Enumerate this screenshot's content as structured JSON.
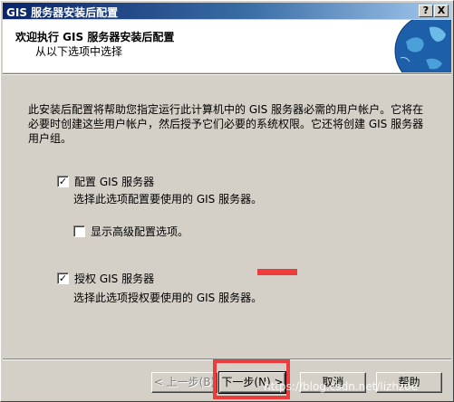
{
  "window": {
    "title": "GIS 服务器安装后配置",
    "help_btn": "?",
    "close_btn": "X"
  },
  "header": {
    "title": "欢迎执行 GIS 服务器安装后配置",
    "subtitle": "从以下选项中选择"
  },
  "description": "此安装后配置将帮助您指定运行此计算机中的 GIS 服务器必需的用户帐户。它将在必要时创建这些用户帐户，然后授予它们必要的系统权限。它还将创建 GIS 服务器用户组。",
  "options": {
    "configure": {
      "label": "配置 GIS 服务器",
      "checked": true,
      "check_glyph": "✓",
      "note": "选择此选项配置要使用的 GIS 服务器。"
    },
    "advanced": {
      "label": "显示高级配置选项。",
      "checked": false
    },
    "authorize": {
      "label": "授权 GIS 服务器",
      "checked": true,
      "check_glyph": "✓",
      "note": "选择此选项授权要使用的 GIS 服务器。"
    }
  },
  "buttons": {
    "back": "< 上一步(B)",
    "next": "下一步(N) >",
    "cancel": "取消",
    "help": "帮助"
  },
  "watermark": "https://blog.csdn.net/lizhzoe",
  "colors": {
    "titlebar": "#0a246a",
    "face": "#d4d0c8",
    "annotation": "#ee3b3b"
  }
}
